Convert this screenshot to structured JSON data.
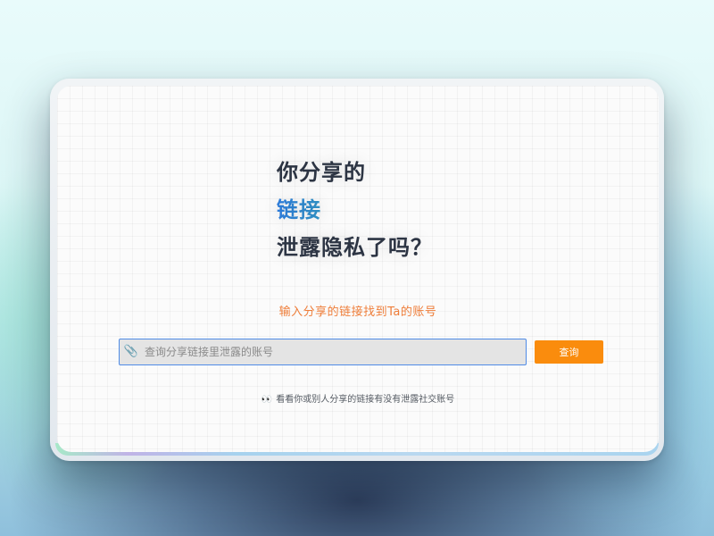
{
  "headline": {
    "line1": "你分享的",
    "line2": "链接",
    "line3": "泄露隐私了吗？"
  },
  "subtitle": "输入分享的链接找到Ta的账号",
  "search": {
    "icon": "paperclip-icon",
    "placeholder": "查询分享链接里泄露的账号",
    "value": ""
  },
  "query_button": {
    "label": "查询",
    "color": "#fa8c0d"
  },
  "hint": {
    "icon": "eyes-icon",
    "text": "看看你或别人分享的链接有没有泄露社交账号"
  },
  "colors": {
    "accent_gradient_start": "#2f7fe0",
    "accent_gradient_end": "#35c98a",
    "subtitle": "#ef7e3a"
  }
}
